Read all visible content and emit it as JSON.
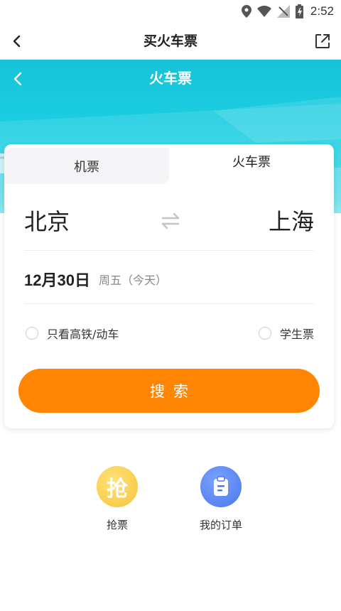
{
  "status_bar": {
    "time": "2:52",
    "icons": [
      "location-icon",
      "wifi-icon",
      "signal-icon",
      "battery-icon"
    ]
  },
  "nav": {
    "title": "买火车票",
    "back_icon": "arrow-left-icon",
    "share_icon": "external-link-icon"
  },
  "hero": {
    "title": "火车票",
    "back_icon": "chevron-left-icon"
  },
  "tabs": [
    {
      "label": "机票",
      "selected": false
    },
    {
      "label": "火车票",
      "selected": true
    }
  ],
  "route": {
    "from": "北京",
    "to": "上海",
    "swap_icon": "swap-arrows-icon"
  },
  "date": {
    "main": "12月30日",
    "weekday": "周五（今天）"
  },
  "options": {
    "high_speed_only": "只看高铁/动车",
    "student_ticket": "学生票"
  },
  "search": {
    "label": "搜索"
  },
  "shortcuts": [
    {
      "label": "抢票",
      "icon": "grab-ticket-icon",
      "glyph": "抢"
    },
    {
      "label": "我的订单",
      "icon": "order-list-icon"
    }
  ],
  "colors": {
    "accent": "#ff8503",
    "hero": "#1ccde0",
    "grab": "#f7c43a",
    "orders": "#4b78ea"
  }
}
